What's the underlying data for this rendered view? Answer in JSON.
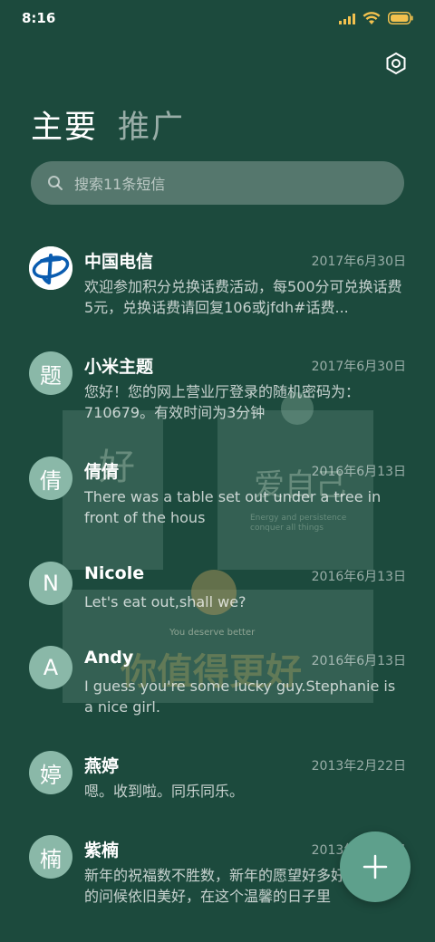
{
  "status_bar": {
    "time": "8:16"
  },
  "tabs": [
    {
      "label": "主要",
      "active": true
    },
    {
      "label": "推广",
      "active": false
    }
  ],
  "search": {
    "placeholder": "搜索11条短信"
  },
  "messages": [
    {
      "name": "中国电信",
      "date": "2017年6月30日",
      "preview": "欢迎参加积分兑换话费活动，每500分可兑换话费5元，兑换话费请回复106或jfdh#话费...",
      "avatar": "telecom-logo"
    },
    {
      "name": "小米主题",
      "date": "2017年6月30日",
      "preview": "您好！您的网上营业厅登录的随机密码为：710679。有效时间为3分钟",
      "avatar": "题"
    },
    {
      "name": "倩倩",
      "date": "2016年6月13日",
      "preview": "There was a table set out under a tree in front of the hous",
      "avatar": "倩"
    },
    {
      "name": "Nicole",
      "date": "2016年6月13日",
      "preview": "Let's eat out,shall we?",
      "avatar": "N"
    },
    {
      "name": "Andy",
      "date": "2016年6月13日",
      "preview": "I guess you're some lucky guy.Stephanie is a nice girl.",
      "avatar": "A"
    },
    {
      "name": "燕婷",
      "date": "2013年2月22日",
      "preview": "嗯。收到啦。同乐同乐。",
      "avatar": "婷"
    },
    {
      "name": "紫楠",
      "date": "2013年2月22日",
      "preview": "新年的祝福数不胜数，新年的愿望好多好多，新年的问候依旧美好，在这个温馨的日子里",
      "avatar": "楠"
    }
  ],
  "overlay": {
    "card1_text": "好",
    "card2_text": "爱自己",
    "card2_sub": "Energy and persistence conquer all things",
    "card3_sub": "You deserve better",
    "card3_text": "你值得更好"
  },
  "colors": {
    "background": "#1c4a3d",
    "avatar": "#8ab8a8",
    "fab": "#5ea08c",
    "signal": "#f2c14e"
  },
  "icons": {
    "settings": "settings-hexagon-icon",
    "search": "search-icon",
    "fab": "plus-icon"
  }
}
